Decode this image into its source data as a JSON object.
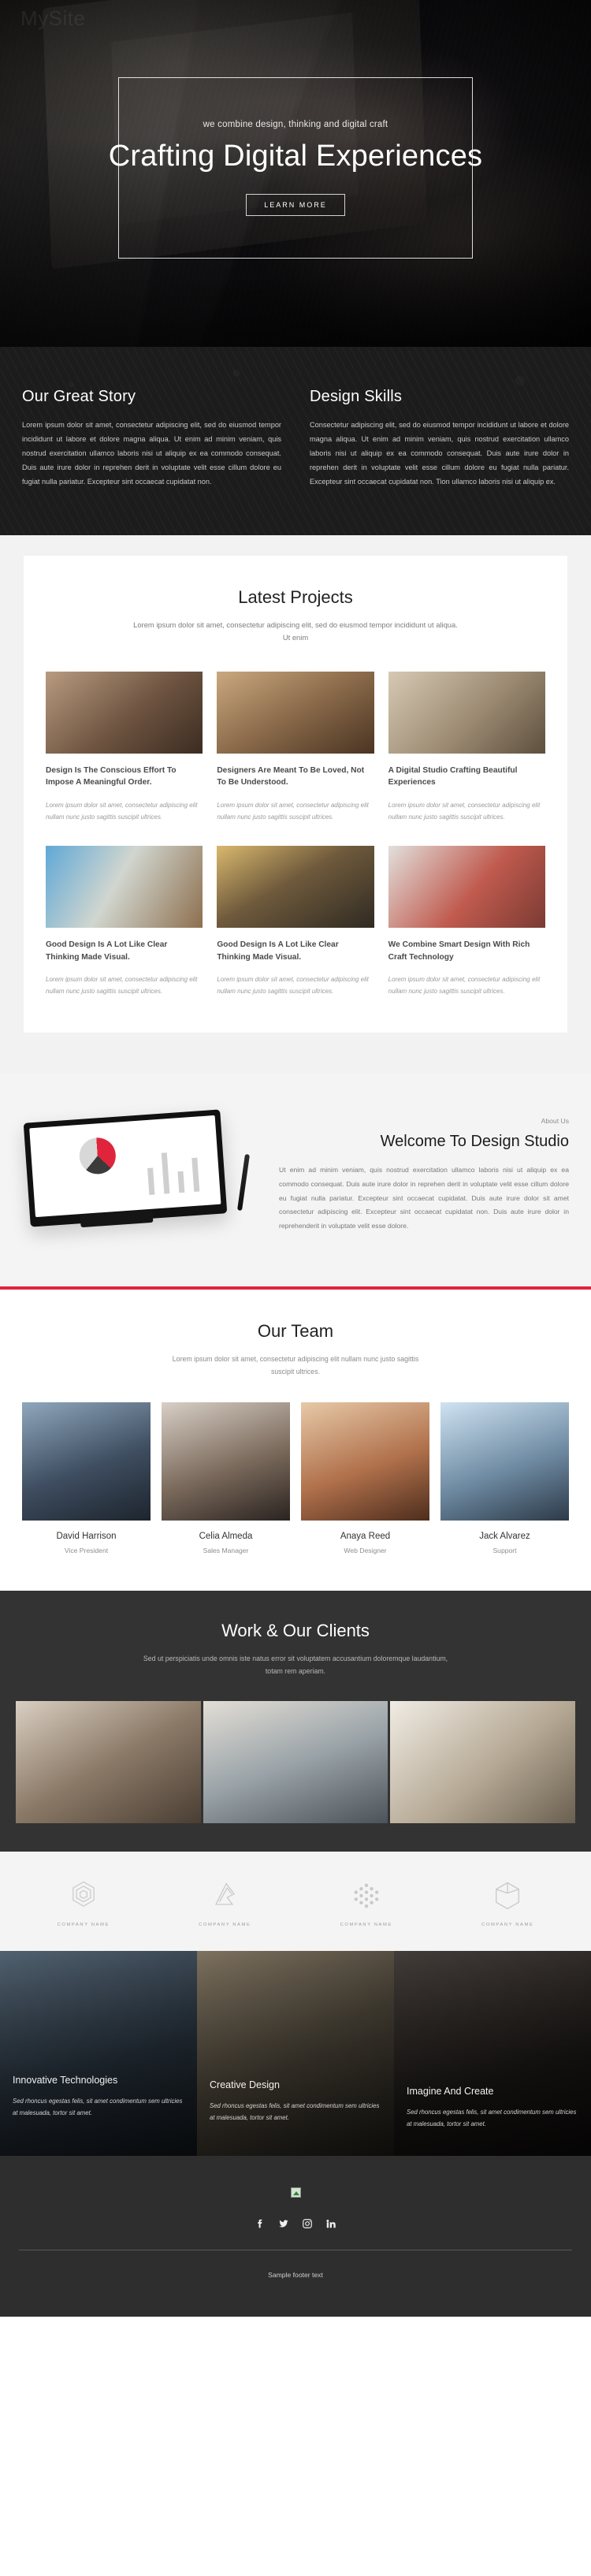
{
  "brand": {
    "logo_text": "MySite"
  },
  "hero": {
    "tagline": "we combine design, thinking and digital craft",
    "title": "Crafting Digital Experiences",
    "button_label": "Learn more"
  },
  "story": {
    "left": {
      "heading": "Our Great Story",
      "body": "Lorem ipsum dolor sit amet, consectetur adipiscing elit, sed do eiusmod tempor incididunt ut labore et dolore magna aliqua. Ut enim ad minim veniam, quis nostrud exercitation ullamco laboris nisi ut aliquip ex ea commodo consequat. Duis aute irure dolor in reprehen derit in voluptate velit esse cillum dolore eu fugiat nulla pariatur. Excepteur sint occaecat cupidatat non."
    },
    "right": {
      "heading": "Design Skills",
      "body": "Consectetur adipiscing elit, sed do eiusmod tempor incididunt ut labore et dolore magna aliqua. Ut enim ad minim veniam, quis nostrud exercitation ullamco laboris nisi ut aliquip ex ea commodo consequat. Duis aute irure dolor in reprehen derit in voluptate velit esse cillum dolore eu fugiat nulla pariatur. Excepteur sint occaecat cupidatat non. Tion ullamco laboris nisi ut aliquip ex."
    }
  },
  "projects": {
    "title": "Latest Projects",
    "subtitle": "Lorem ipsum dolor sit amet, consectetur adipiscing elit, sed do eiusmod tempor incididunt ut aliqua. Ut enim",
    "items": [
      {
        "title": "Design Is The Conscious Effort To Impose A Meaningful Order.",
        "text": "Lorem ipsum dolor sit amet, consectetur adipiscing elit nullam nunc justo sagittis suscipit ultrices."
      },
      {
        "title": "Designers Are Meant To Be Loved, Not To Be Understood.",
        "text": "Lorem ipsum dolor sit amet, consectetur adipiscing elit nullam nunc justo sagittis suscipit ultrices."
      },
      {
        "title": "A Digital Studio Crafting Beautiful Experiences",
        "text": "Lorem ipsum dolor sit amet, consectetur adipiscing elit nullam nunc justo sagittis suscipit ultrices."
      },
      {
        "title": "Good Design Is A Lot Like Clear Thinking Made Visual.",
        "text": "Lorem ipsum dolor sit amet, consectetur adipiscing elit nullam nunc justo sagittis suscipit ultrices."
      },
      {
        "title": "Good Design Is A Lot Like Clear Thinking Made Visual.",
        "text": "Lorem ipsum dolor sit amet, consectetur adipiscing elit nullam nunc justo sagittis suscipit ultrices."
      },
      {
        "title": "We Combine Smart Design With Rich Craft Technology",
        "text": "Lorem ipsum dolor sit amet, consectetur adipiscing elit nullam nunc justo sagittis suscipit ultrices."
      }
    ]
  },
  "about": {
    "kicker": "About Us",
    "heading": "Welcome To Design Studio",
    "body": "Ut enim ad minim veniam, quis nostrud exercitation ullamco laboris nisi ut aliquip ex ea commodo consequat. Duis aute irure dolor in reprehen derit in voluptate velit esse cillum dolore eu fugiat nulla pariatur. Excepteur sint occaecat cupidatat. Duis aute irure dolor sit amet consectetur adipiscing elit. Excepteur sint occaecat cupidatat non. Duis aute irure dolor in reprehenderit in voluptate velit esse dolore."
  },
  "team": {
    "title": "Our Team",
    "subtitle": "Lorem ipsum dolor sit amet, consectetur adipiscing elit nullam nunc justo sagittis suscipit ultrices.",
    "members": [
      {
        "name": "David Harrison",
        "role": "Vice President"
      },
      {
        "name": "Celia Almeda",
        "role": "Sales Manager"
      },
      {
        "name": "Anaya Reed",
        "role": "Web Designer"
      },
      {
        "name": "Jack Alvarez",
        "role": "Support"
      }
    ]
  },
  "clients": {
    "title": "Work & Our Clients",
    "subtitle": "Sed ut perspiciatis unde omnis iste natus error sit voluptatem accusantium doloremque laudantium, totam rem aperiam.",
    "logos": [
      {
        "caption": "Company Name",
        "icon": "hexagon-layers-icon"
      },
      {
        "caption": "Company Name",
        "icon": "chevron-arrow-icon"
      },
      {
        "caption": "Company Name",
        "icon": "dot-grid-hexagon-icon"
      },
      {
        "caption": "Company Name",
        "icon": "cube-outline-icon"
      }
    ]
  },
  "features": [
    {
      "title": "Innovative Technologies",
      "text": "Sed rhoncus egestas felis, sit amet condimentum sem ultricies at malesuada, tortor sit amet."
    },
    {
      "title": "Creative Design",
      "text": "Sed rhoncus egestas felis, sit amet condimentum sem ultricies at malesuada, tortor sit amet."
    },
    {
      "title": "Imagine And Create",
      "text": "Sed rhoncus egestas felis, sit amet condimentum sem ultricies at malesuada, tortor sit amet."
    }
  ],
  "footer": {
    "social": [
      "facebook-icon",
      "twitter-icon",
      "instagram-icon",
      "linkedin-icon"
    ],
    "text": "Sample footer text"
  },
  "colors": {
    "accent": "#e0243c",
    "dark": "#1c1c1c",
    "footer_bg": "#2e2e2e"
  }
}
